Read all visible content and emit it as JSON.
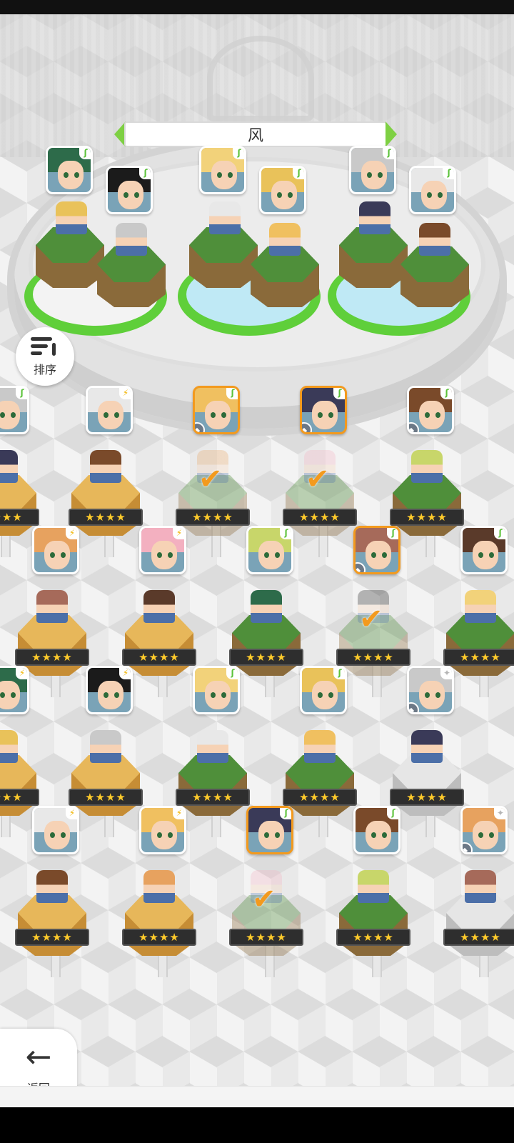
{
  "header": {
    "element_title": "风"
  },
  "controls": {
    "sort_label": "排序",
    "back_label": "返回"
  },
  "icons": {
    "sort": "sort-icon",
    "back": "arrow-left-icon",
    "wind": "wind-element-icon",
    "lightning": "lightning-element-icon",
    "star": "star-element-icon",
    "level": "level-badge-icon",
    "check": "checkmark-icon"
  },
  "colors": {
    "accent_green": "#7ed043",
    "selected_orange": "#f39a1e",
    "star_gold": "#ffcb2b"
  },
  "team_slots": [
    {
      "id": "slot-1",
      "heroes": [
        "wind-hero-green-hair",
        "wind-hero-black-hair"
      ]
    },
    {
      "id": "slot-2",
      "heroes": [
        "wind-hero-blonde-crown",
        "wind-hero-blonde-braid"
      ]
    },
    {
      "id": "slot-3",
      "heroes": [
        "wind-hero-silver-glasses",
        "wind-hero-white-tiger"
      ]
    }
  ],
  "roster": {
    "star_label": "★★★★",
    "rows": [
      [
        {
          "elem": "wind",
          "hex": "gold",
          "selected": false
        },
        {
          "elem": "light",
          "hex": "gold",
          "selected": false
        },
        {
          "elem": "wind",
          "hex": "grass",
          "selected": true,
          "badge": true
        },
        {
          "elem": "wind",
          "hex": "grass",
          "selected": true,
          "badge": true
        },
        {
          "elem": "wind",
          "hex": "grass",
          "selected": false,
          "badge": true
        }
      ],
      [
        {
          "elem": "light",
          "hex": "gold",
          "selected": false
        },
        {
          "elem": "light",
          "hex": "gold",
          "selected": false
        },
        {
          "elem": "wind",
          "hex": "grass",
          "selected": false
        },
        {
          "elem": "wind",
          "hex": "grass",
          "selected": true,
          "badge": true
        },
        {
          "elem": "wind",
          "hex": "grass",
          "selected": false
        }
      ],
      [
        {
          "elem": "light",
          "hex": "gold",
          "selected": false
        },
        {
          "elem": "light",
          "hex": "gold",
          "selected": false
        },
        {
          "elem": "wind",
          "hex": "grass",
          "selected": false
        },
        {
          "elem": "wind",
          "hex": "grass",
          "selected": false
        },
        {
          "elem": "star",
          "hex": "stone",
          "selected": false,
          "badge": true
        }
      ],
      [
        {
          "elem": "light",
          "hex": "gold",
          "selected": false
        },
        {
          "elem": "light",
          "hex": "gold",
          "selected": false
        },
        {
          "elem": "wind",
          "hex": "grass",
          "selected": true
        },
        {
          "elem": "wind",
          "hex": "grass",
          "selected": false
        },
        {
          "elem": "star",
          "hex": "stone",
          "selected": false,
          "badge": true
        }
      ]
    ]
  }
}
